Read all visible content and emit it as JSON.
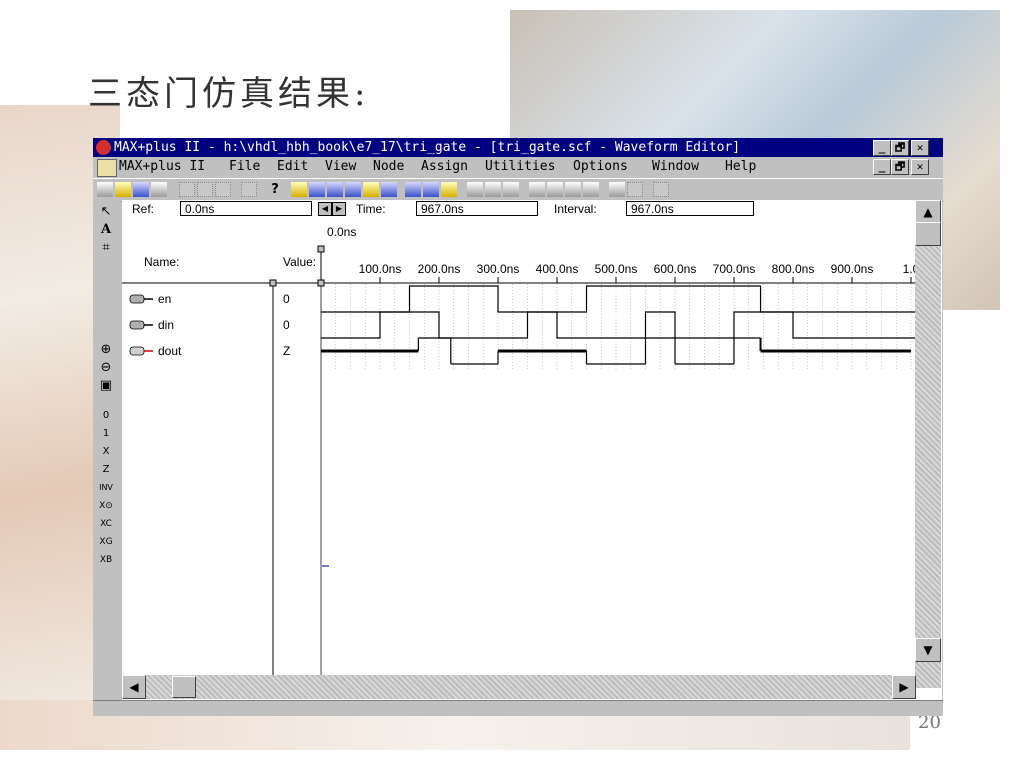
{
  "slide": {
    "title": "三态门仿真结果:",
    "page_number": "20"
  },
  "window": {
    "title": "MAX+plus II - h:\\vhdl_hbh_book\\e7_17\\tri_gate - [tri_gate.scf - Waveform Editor]",
    "buttons": {
      "minimize": "_",
      "restore": "🗗",
      "close": "✕"
    }
  },
  "menu": {
    "items": [
      "MAX+plus II",
      "File",
      "Edit",
      "View",
      "Node",
      "Assign",
      "Utilities",
      "Options",
      "Window",
      "Help"
    ]
  },
  "waveform": {
    "ref_label": "Ref:",
    "ref_value": "0.0ns",
    "time_label": "Time:",
    "time_value": "967.0ns",
    "interval_label": "Interval:",
    "interval_value": "967.0ns",
    "cursor_label": "0.0ns",
    "name_header": "Name:",
    "value_header": "Value:",
    "time_ticks": [
      "100.0ns",
      "200.0ns",
      "300.0ns",
      "400.0ns",
      "500.0ns",
      "600.0ns",
      "700.0ns",
      "800.0ns",
      "900.0ns",
      "1.0"
    ],
    "signals": [
      {
        "name": "en",
        "value": "0",
        "kind": "input",
        "transitions": [
          150,
          300,
          450,
          745
        ],
        "initial": 0
      },
      {
        "name": "din",
        "value": "0",
        "kind": "input",
        "transitions": [
          100,
          200,
          350,
          400,
          550,
          600,
          700,
          800
        ],
        "initial": 0
      },
      {
        "name": "dout",
        "value": "Z",
        "kind": "output",
        "segments": [
          {
            "from": 0,
            "to": 165,
            "state": "Z"
          },
          {
            "from": 165,
            "to": 220,
            "state": "1"
          },
          {
            "from": 220,
            "to": 300,
            "state": "0"
          },
          {
            "from": 300,
            "to": 450,
            "state": "Z"
          },
          {
            "from": 450,
            "to": 550,
            "state": "0"
          },
          {
            "from": 550,
            "to": 600,
            "state": "1"
          },
          {
            "from": 600,
            "to": 700,
            "state": "0"
          },
          {
            "from": 700,
            "to": 745,
            "state": "1"
          },
          {
            "from": 745,
            "to": 1000,
            "state": "Z"
          }
        ]
      }
    ]
  }
}
